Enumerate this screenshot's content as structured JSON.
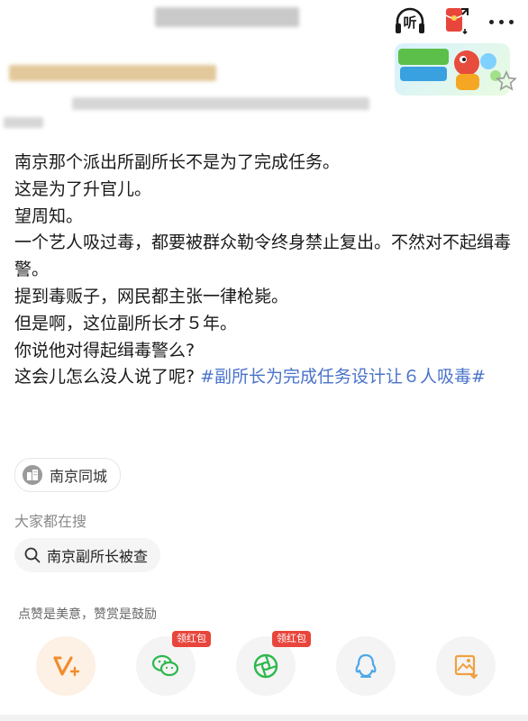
{
  "header": {
    "listen_label": "听"
  },
  "post": {
    "lines": [
      "南京那个派出所副所长不是为了完成任务。",
      "这是为了升官儿。",
      "望周知。",
      "一个艺人吸过毒，都要被群众勒令终身禁止复出。不然对不起缉毒警。",
      "提到毒贩子，网民都主张一律枪毙。",
      "但是啊，这位副所长才５年。",
      "你说他对得起缉毒警么?"
    ],
    "last_line_text": "这会儿怎么没人说了呢? ",
    "topic": "#副所长为完成任务设计让６人吸毒#"
  },
  "location": {
    "label": "南京同城"
  },
  "search": {
    "title": "大家都在搜",
    "query": "南京副所长被查"
  },
  "reward": {
    "note": "点赞是美意，赞赏是鼓励"
  },
  "actions": {
    "wechat_tag": "领红包",
    "moments_tag": "领红包"
  },
  "colors": {
    "topic": "#4a73c9",
    "accent_orange": "#f08c2c",
    "wechat_green": "#2db84d",
    "qq_blue": "#4aa8e8",
    "tag_red": "#e8463c"
  }
}
